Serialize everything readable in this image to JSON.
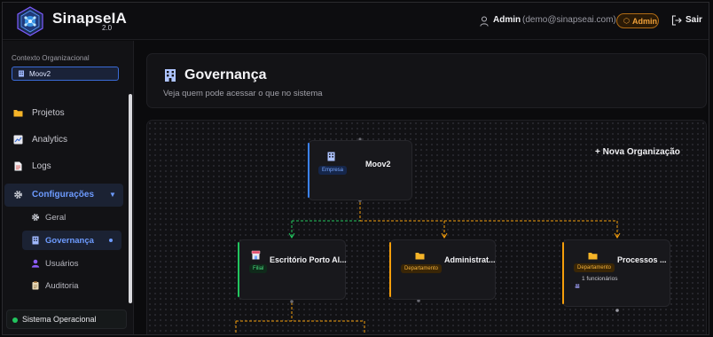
{
  "app": {
    "name": "SinapseIA",
    "version": "2.0"
  },
  "header": {
    "user_name": "Admin",
    "user_email": "(demo@sinapseai.com)",
    "role_badge": "Admin",
    "logout_label": "Sair"
  },
  "sidebar": {
    "context_label": "Contexto Organizacional",
    "context_value": "Moov2",
    "items": [
      {
        "label": "Projetos",
        "icon": "folder-icon"
      },
      {
        "label": "Analytics",
        "icon": "chart-icon"
      },
      {
        "label": "Logs",
        "icon": "document-icon"
      },
      {
        "label": "Configurações",
        "icon": "gear-icon"
      }
    ],
    "subitems": [
      {
        "label": "Geral",
        "icon": "gear-icon"
      },
      {
        "label": "Governança",
        "icon": "building-icon"
      },
      {
        "label": "Usuários",
        "icon": "user-icon"
      },
      {
        "label": "Auditoria",
        "icon": "clipboard-icon"
      }
    ],
    "status": "Sistema Operacional"
  },
  "page": {
    "title": "Governança",
    "subtitle": "Veja quem pode acessar o que no sistema"
  },
  "org_chart": {
    "new_org_label": "+ Nova Organização",
    "nodes": [
      {
        "name": "Moov2",
        "tag": "Empresa",
        "tag_color": "#3b82f6"
      },
      {
        "name": "Escritório Porto Al...",
        "tag": "Filial",
        "tag_color": "#22c55e"
      },
      {
        "name": "Administrat...",
        "tag": "Departamento",
        "tag_color": "#f59e0b"
      },
      {
        "name": "Processos ...",
        "tag": "Departamento",
        "tag_color": "#f59e0b",
        "subtitle": "1 funcionários"
      }
    ]
  },
  "colors": {
    "accent": "#3b82f6",
    "branch": "#22c55e",
    "department": "#f59e0b"
  }
}
